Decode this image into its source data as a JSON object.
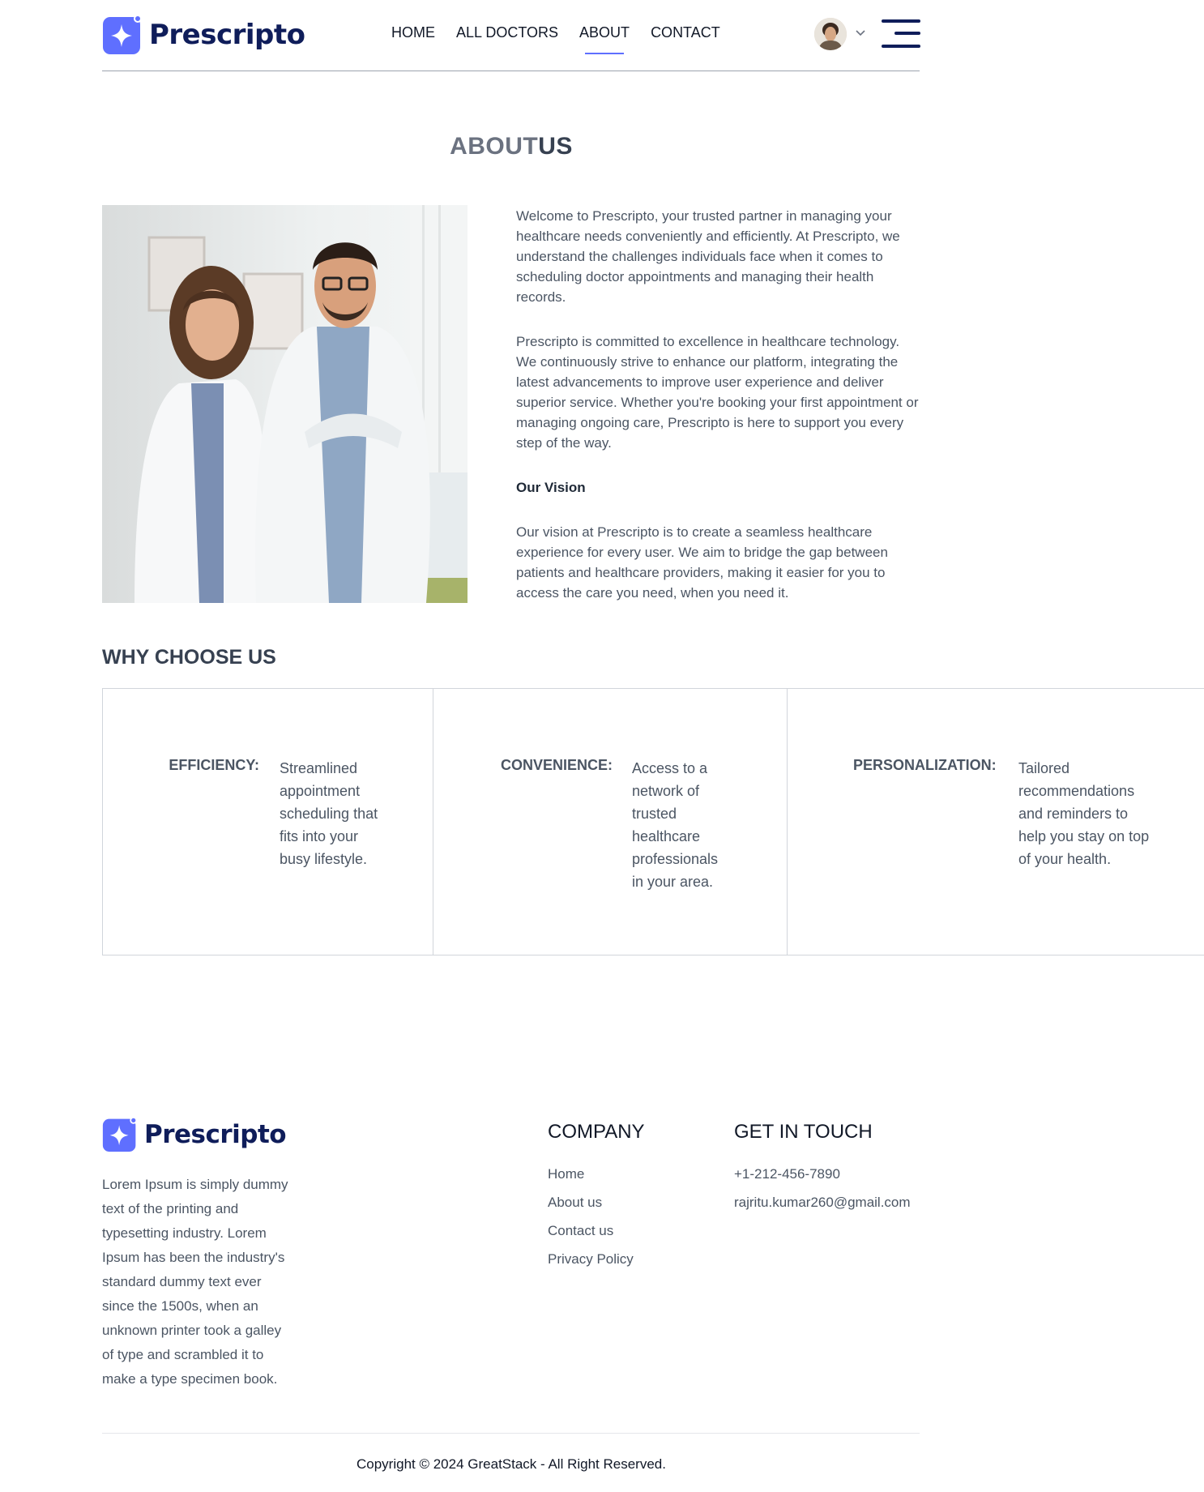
{
  "brand": {
    "name": "Prescripto",
    "color": "#5f6fff",
    "text_color": "#0f1d5a"
  },
  "nav": {
    "items": [
      {
        "label": "HOME",
        "active": false
      },
      {
        "label": "ALL DOCTORS",
        "active": false
      },
      {
        "label": "ABOUT",
        "active": true
      },
      {
        "label": "CONTACT",
        "active": false
      }
    ],
    "profile_icon": "user-avatar",
    "dropdown_icon": "chevron-down-icon",
    "menu_icon": "hamburger-menu-icon"
  },
  "about": {
    "title_light": "ABOUT",
    "title_bold": "US",
    "image_alt": "doctors-photo",
    "paragraph_1": "Welcome to Prescripto, your trusted partner in managing your healthcare needs conveniently and efficiently. At Prescripto, we understand the challenges individuals face when it comes to scheduling doctor appointments and managing their health records.",
    "paragraph_2": "Prescripto is committed to excellence in healthcare technology. We continuously strive to enhance our platform, integrating the latest advancements to improve user experience and deliver superior service. Whether you're booking your first appointment or managing ongoing care, Prescripto is here to support you every step of the way.",
    "vision_heading": "Our Vision",
    "vision_text": "Our vision at Prescripto is to create a seamless healthcare experience for every user. We aim to bridge the gap between patients and healthcare providers, making it easier for you to access the care you need, when you need it."
  },
  "why": {
    "title_light": "WHY",
    "title_bold": "CHOOSE US",
    "cards": [
      {
        "label": "EFFICIENCY:",
        "text": "Streamlined appointment scheduling that fits into your busy lifestyle."
      },
      {
        "label": "CONVENIENCE:",
        "text": "Access to a network of trusted healthcare professionals in your area."
      },
      {
        "label": "PERSONALIZATION:",
        "text": "Tailored recommendations and reminders to help you stay on top of your health."
      }
    ]
  },
  "footer": {
    "description": "Lorem Ipsum is simply dummy text of the printing and typesetting industry. Lorem Ipsum has been the industry's standard dummy text ever since the 1500s, when an unknown printer took a galley of type and scrambled it to make a type specimen book.",
    "company_heading": "COMPANY",
    "company_links": [
      "Home",
      "About us",
      "Contact us",
      "Privacy Policy"
    ],
    "contact_heading": "GET IN TOUCH",
    "phone": "+1-212-456-7890",
    "email": "rajritu.kumar260@gmail.com",
    "copyright": "Copyright © 2024 GreatStack - All Right Reserved."
  }
}
